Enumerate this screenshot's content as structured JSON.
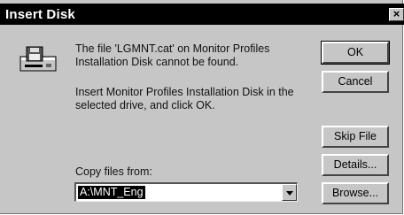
{
  "dialog": {
    "title": "Insert Disk",
    "close_label": "×",
    "message_1": "The file 'LGMNT.cat' on Monitor Profiles Installation Disk cannot be found.",
    "message_2": "Insert Monitor Profiles Installation Disk in the selected drive, and click OK.",
    "copy_label": "Copy files from:",
    "copy_value": "A:\\MNT_Eng"
  },
  "buttons": {
    "ok": "OK",
    "cancel": "Cancel",
    "skip": "Skip File",
    "details": "Details...",
    "browse": "Browse..."
  },
  "icons": {
    "drive": "floppy-drive-icon",
    "dropdown": "chevron-down-icon"
  }
}
